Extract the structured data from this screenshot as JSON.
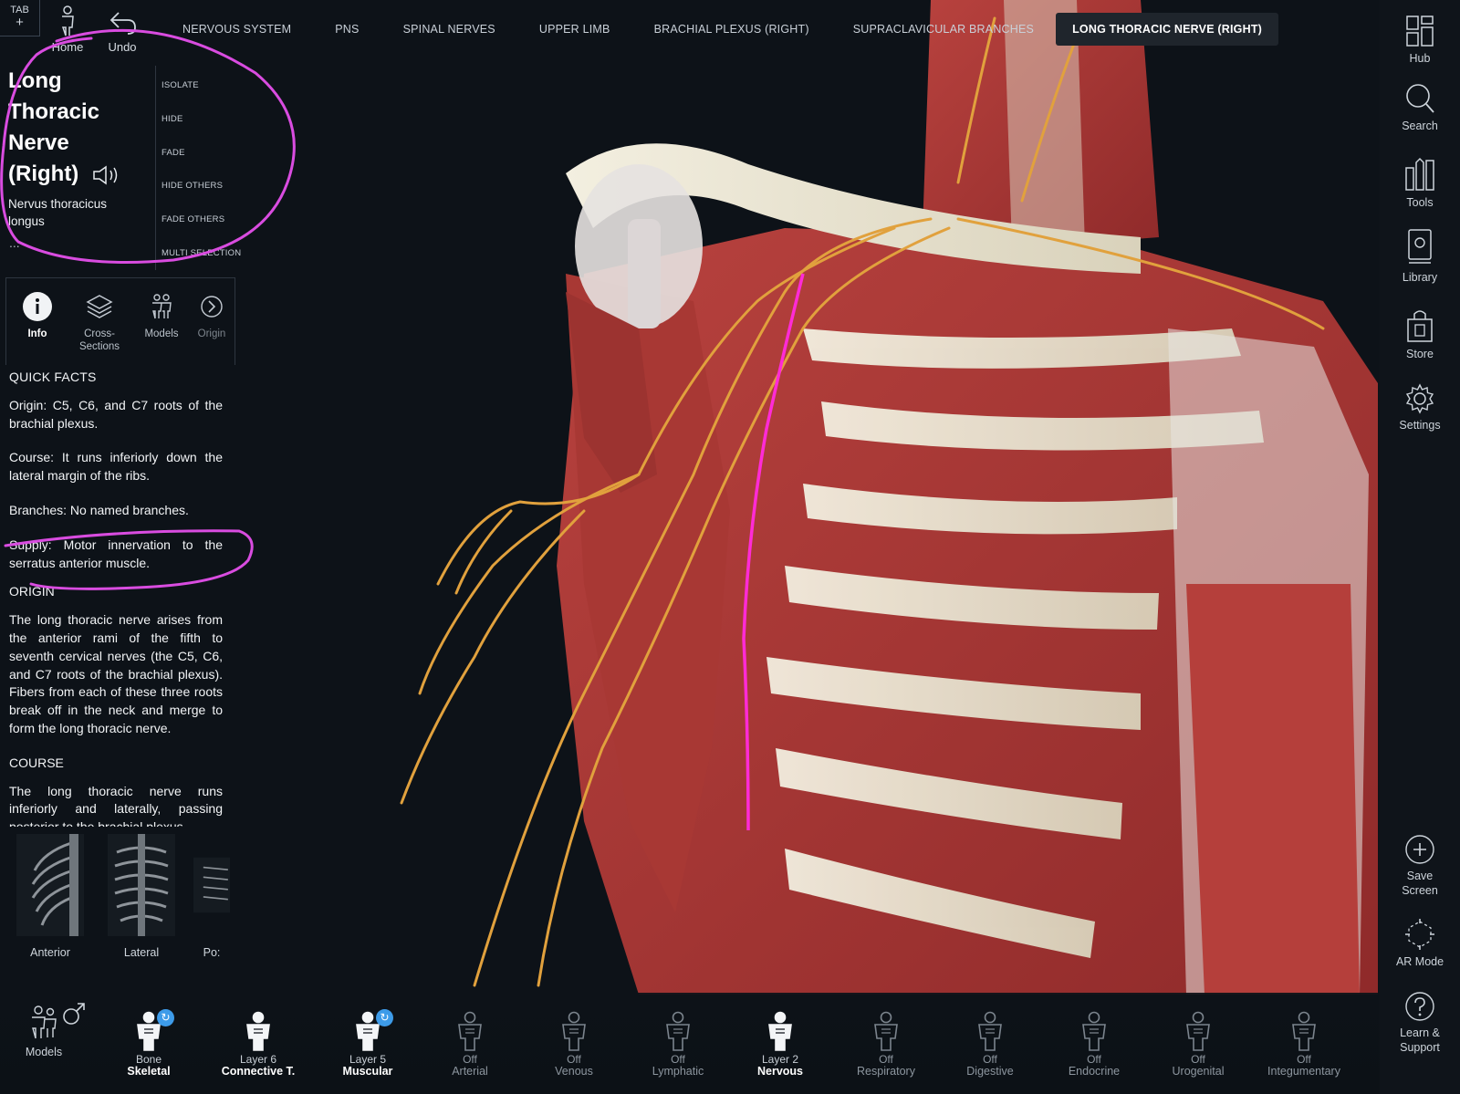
{
  "colors": {
    "accent_active_tab": "#1f252c",
    "annotation_magenta": "#d94ce0",
    "nerve_yellow": "#e1a13d",
    "highlight_nerve": "#ff2bd6",
    "badge_blue": "#3d9be9"
  },
  "top": {
    "tab_label": "TAB",
    "tab_plus": "+",
    "home_label": "Home",
    "undo_label": "Undo",
    "breadcrumb": [
      "NERVOUS SYSTEM",
      "PNS",
      "SPINAL NERVES",
      "UPPER LIMB",
      "BRACHIAL PLEXUS (RIGHT)",
      "SUPRACLAVICULAR BRANCHES",
      "LONG THORACIC NERVE (RIGHT)"
    ]
  },
  "structure": {
    "title": "Long Thoracic Nerve (Right)",
    "latin": "Nervus thoracicus longus",
    "more": "..."
  },
  "actions": [
    "ISOLATE",
    "HIDE",
    "FADE",
    "HIDE OTHERS",
    "FADE OTHERS",
    "MULTI SELECTION"
  ],
  "panel_tabs": [
    {
      "label": "Info",
      "icon": "info-icon"
    },
    {
      "label": "Cross-Sections",
      "icon": "layers-icon"
    },
    {
      "label": "Models",
      "icon": "models-icon"
    },
    {
      "label": "Origin",
      "icon": "chevron-right-icon"
    }
  ],
  "info": {
    "quick_facts_heading": "QUICK FACTS",
    "origin_fact": "Origin: C5, C6, and C7 roots of the brachial plexus.",
    "course_fact": "Course: It runs inferiorly down the lateral margin of the ribs.",
    "branches_fact": "Branches: No named branches.",
    "supply_fact": "Supply: Motor innervation to the serratus anterior muscle.",
    "origin_heading": "ORIGIN",
    "origin_text": "The long thoracic nerve arises from the anterior rami of the fifth to seventh cervical nerves (the C5, C6, and C7 roots of the brachial plexus). Fibers from each of these three roots break off in the neck and merge to form the long thoracic nerve.",
    "course_heading": "COURSE",
    "course_text": "The long thoracic nerve runs inferiorly and laterally, passing posterior to the brachial plexus"
  },
  "thumbnails": [
    "Anterior",
    "Lateral",
    "Po:"
  ],
  "right_bar": [
    {
      "label": "Hub",
      "icon": "hub-icon"
    },
    {
      "label": "Search",
      "icon": "search-icon"
    },
    {
      "label": "Tools",
      "icon": "tools-icon"
    },
    {
      "label": "Library",
      "icon": "library-icon"
    },
    {
      "label": "Store",
      "icon": "store-icon"
    },
    {
      "label": "Settings",
      "icon": "gear-icon"
    },
    {
      "label": "Save Screen",
      "icon": "plus-icon"
    },
    {
      "label": "AR Mode",
      "icon": "ar-icon"
    },
    {
      "label": "Learn & Support",
      "icon": "help-icon"
    }
  ],
  "layers": {
    "models_label": "Models",
    "items": [
      {
        "state": "Bone",
        "name": "Skeletal",
        "on": true,
        "badge": true
      },
      {
        "state": "Layer 6",
        "name": "Connective T.",
        "on": true,
        "badge": false
      },
      {
        "state": "Layer 5",
        "name": "Muscular",
        "on": true,
        "badge": true
      },
      {
        "state": "Off",
        "name": "Arterial",
        "on": false,
        "badge": false
      },
      {
        "state": "Off",
        "name": "Venous",
        "on": false,
        "badge": false
      },
      {
        "state": "Off",
        "name": "Lymphatic",
        "on": false,
        "badge": false
      },
      {
        "state": "Layer 2",
        "name": "Nervous",
        "on": true,
        "badge": false
      },
      {
        "state": "Off",
        "name": "Respiratory",
        "on": false,
        "badge": false
      },
      {
        "state": "Off",
        "name": "Digestive",
        "on": false,
        "badge": false
      },
      {
        "state": "Off",
        "name": "Endocrine",
        "on": false,
        "badge": false
      },
      {
        "state": "Off",
        "name": "Urogenital",
        "on": false,
        "badge": false
      },
      {
        "state": "Off",
        "name": "Integumentary",
        "on": false,
        "badge": false
      }
    ]
  }
}
